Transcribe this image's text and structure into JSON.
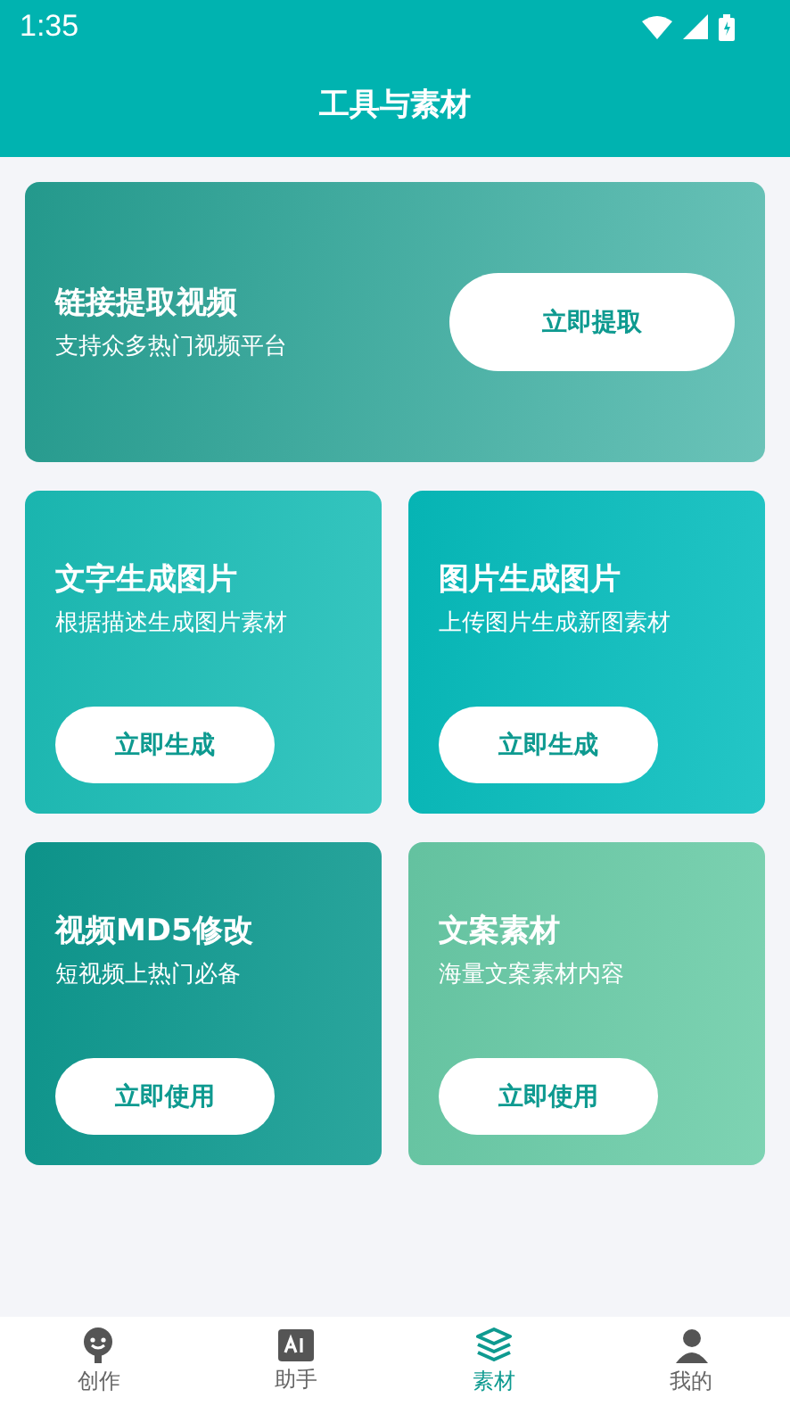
{
  "status_bar": {
    "time": "1:35"
  },
  "header": {
    "title": "工具与素材"
  },
  "cards": [
    {
      "kind": "wide",
      "title": "链接提取视频",
      "subtitle": "支持众多热门视频平台",
      "button": "立即提取",
      "color": "#2aa99a"
    },
    {
      "kind": "tile",
      "title": "文字生成图片",
      "subtitle": "根据描述生成图片素材",
      "button": "立即生成",
      "color": "#1cbfb8"
    },
    {
      "kind": "tile",
      "title": "图片生成图片",
      "subtitle": "上传图片生成新图素材",
      "button": "立即生成",
      "color": "#06bebe"
    },
    {
      "kind": "tile",
      "title": "视频MD5修改",
      "subtitle": "短视频上热门必备",
      "button": "立即使用",
      "color": "#0e9a90"
    },
    {
      "kind": "tile",
      "title": "文案素材",
      "subtitle": "海量文案素材内容",
      "button": "立即使用",
      "color": "#6ccda8"
    }
  ],
  "nav": [
    {
      "label": "创作",
      "selected": false
    },
    {
      "label": "助手",
      "selected": false
    },
    {
      "label": "素材",
      "selected": true
    },
    {
      "label": "我的",
      "selected": false
    }
  ]
}
